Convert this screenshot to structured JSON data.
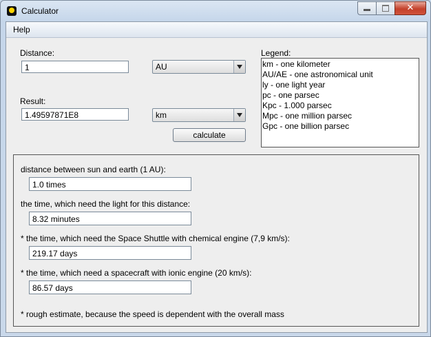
{
  "window": {
    "title": "Calculator",
    "close_glyph": "✕"
  },
  "menu": {
    "help": "Help"
  },
  "distance": {
    "label": "Distance:",
    "value": "1",
    "unit": "AU"
  },
  "result": {
    "label": "Result:",
    "value": "1.49597871E8",
    "unit": "km"
  },
  "calculate_label": "calculate",
  "legend": {
    "label": "Legend:",
    "lines": [
      "km - one kilometer",
      "AU/AE - one astronomical unit",
      "ly - one light year",
      "pc - one parsec",
      "Kpc - 1.000 parsec",
      "Mpc - one million parsec",
      "Gpc - one billion parsec"
    ]
  },
  "info": {
    "items": [
      {
        "label": "distance between sun and earth (1 AU):",
        "value": "1.0 times"
      },
      {
        "label": "the time, which need the light for this distance:",
        "value": "8.32 minutes"
      },
      {
        "label": "* the time, which need the Space Shuttle with chemical engine (7,9 km/s):",
        "value": "219.17 days"
      },
      {
        "label": "* the time, which need a spacecraft with ionic engine (20 km/s):",
        "value": "86.57 days"
      }
    ],
    "footnote": "* rough estimate, because the speed is dependent with the overall mass"
  },
  "icons": {
    "app": "calculator-app-icon",
    "dropdown": "chevron-down-icon"
  }
}
